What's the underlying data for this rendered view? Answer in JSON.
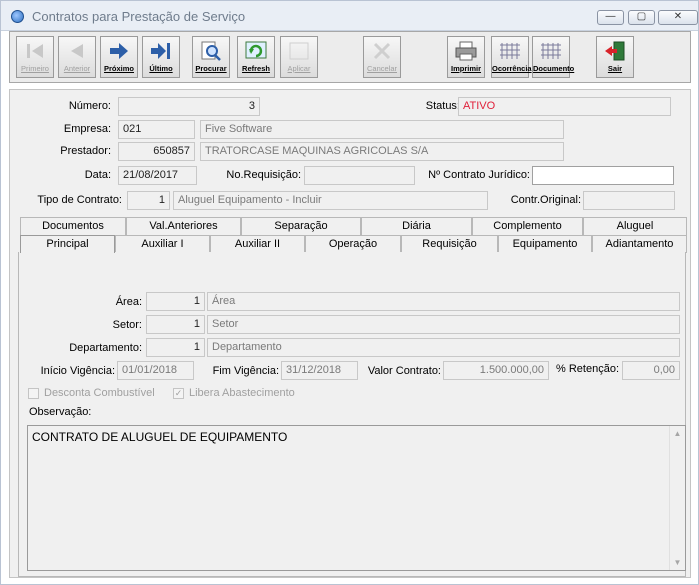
{
  "window": {
    "title": "Contratos para Prestação de Serviço",
    "buttons": {
      "minimize": "—",
      "maximize": "▢",
      "close": "✕"
    }
  },
  "toolbar": {
    "items": [
      {
        "label": "Primeiro",
        "icon": "first-record-icon",
        "enabled": false
      },
      {
        "label": "Anterior",
        "icon": "previous-record-icon",
        "enabled": false
      },
      {
        "label": "Próximo",
        "icon": "next-record-icon",
        "enabled": true
      },
      {
        "label": "Último",
        "icon": "last-record-icon",
        "enabled": true
      },
      {
        "label": "Procurar",
        "icon": "search-icon",
        "enabled": true
      },
      {
        "label": "Refresh",
        "icon": "refresh-icon",
        "enabled": true
      },
      {
        "label": "Aplicar",
        "icon": "apply-icon",
        "enabled": false
      },
      {
        "label": "Cancelar",
        "icon": "cancel-icon",
        "enabled": false
      },
      {
        "label": "Imprimir",
        "icon": "printer-icon",
        "enabled": true
      },
      {
        "label": "Ocorrência",
        "icon": "grid-icon",
        "enabled": true
      },
      {
        "label": "Documento",
        "icon": "grid-icon",
        "enabled": true
      },
      {
        "label": "Sair",
        "icon": "exit-door-icon",
        "enabled": true
      }
    ]
  },
  "form": {
    "numero": {
      "label": "Número:",
      "value": "3"
    },
    "status": {
      "label": "Status:",
      "value": "ATIVO"
    },
    "empresa": {
      "label": "Empresa:",
      "code": "021",
      "name": "Five Software"
    },
    "prestador": {
      "label": "Prestador:",
      "code": "650857",
      "name": "TRATORCASE MAQUINAS AGRICOLAS S/A"
    },
    "data": {
      "label": "Data:",
      "value": "21/08/2017"
    },
    "requisicao": {
      "label": "No.Requisição:",
      "value": ""
    },
    "contrato_juridico": {
      "label": "Nº Contrato Jurídico:",
      "value": ""
    },
    "tipo_contrato": {
      "label": "Tipo de Contrato:",
      "code": "1",
      "name": "Aluguel Equipamento - Incluir"
    },
    "contr_original": {
      "label": "Contr.Original:",
      "value": ""
    }
  },
  "tabs": {
    "back_row": [
      "Documentos",
      "Val.Anteriores",
      "Separação",
      "Diária",
      "Complemento",
      "Aluguel"
    ],
    "front_row": [
      "Principal",
      "Auxiliar I",
      "Auxiliar II",
      "Operação",
      "Requisição",
      "Equipamento",
      "Adiantamento"
    ],
    "active": "Principal"
  },
  "principal": {
    "area": {
      "label": "Área:",
      "code": "1",
      "name": "Área"
    },
    "setor": {
      "label": "Setor:",
      "code": "1",
      "name": "Setor"
    },
    "departamento": {
      "label": "Departamento:",
      "code": "1",
      "name": "Departamento"
    },
    "inicio_vigencia": {
      "label": "Início Vigência:",
      "value": "01/01/2018"
    },
    "fim_vigencia": {
      "label": "Fim Vigência:",
      "value": "31/12/2018"
    },
    "valor_contrato": {
      "label": "Valor Contrato:",
      "value": "1.500.000,00"
    },
    "retencao": {
      "label": "% Retenção:",
      "value": "0,00"
    },
    "desconta_combustivel": {
      "label": "Desconta Combustível",
      "checked": false
    },
    "libera_abastecimento": {
      "label": "Libera Abastecimento",
      "checked": true
    },
    "observacao": {
      "label": "Observação:",
      "value": "CONTRATO DE ALUGUEL DE EQUIPAMENTO"
    }
  }
}
